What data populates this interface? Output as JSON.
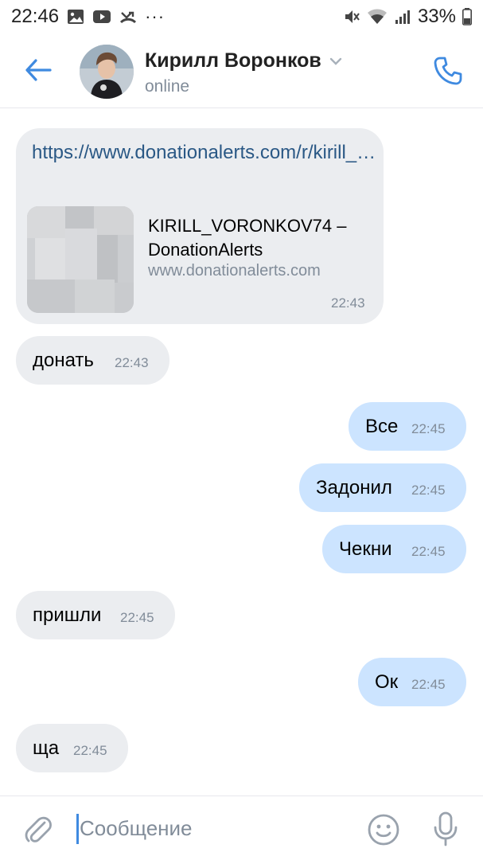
{
  "status_bar": {
    "time": "22:46",
    "dots": "···",
    "battery": "33%"
  },
  "header": {
    "contact_name": "Кирилл Воронков",
    "status": "online"
  },
  "colors": {
    "accent": "#3f8ae0",
    "incoming_bubble": "#ebedf0",
    "outgoing_bubble": "#cce4ff",
    "link": "#2a5885",
    "secondary_text": "#818c99"
  },
  "messages": [
    {
      "direction": "incoming",
      "type": "link",
      "link_text": "https://www.donationalerts.com/r/kirill_…",
      "snippet_title": "KIRILL_VORONKOV74 – DonationAlerts",
      "snippet_domain": "www.donationalerts.com",
      "time": "22:43"
    },
    {
      "direction": "incoming",
      "text": "донать",
      "time": "22:43"
    },
    {
      "direction": "outgoing",
      "text": "Все",
      "time": "22:45"
    },
    {
      "direction": "outgoing",
      "text": "Задонил",
      "time": "22:45"
    },
    {
      "direction": "outgoing",
      "text": "Чекни",
      "time": "22:45"
    },
    {
      "direction": "incoming",
      "text": "пришли",
      "time": "22:45"
    },
    {
      "direction": "outgoing",
      "text": "Ок",
      "time": "22:45"
    },
    {
      "direction": "incoming",
      "text": "ща",
      "time": "22:45"
    }
  ],
  "composer": {
    "placeholder": "Сообщение"
  },
  "icons": {
    "back": "arrow-left-icon",
    "call": "phone-icon",
    "attach": "paperclip-icon",
    "emoji": "smile-icon",
    "mic": "microphone-icon",
    "dropdown": "chevron-down-icon"
  }
}
